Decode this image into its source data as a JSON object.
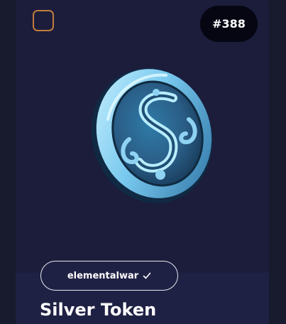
{
  "card": {
    "badge_number": "#388",
    "creator": {
      "name": "elementalwar",
      "icon": "check-icon"
    },
    "token_name": "Silver Token",
    "image_subject": "coin-icon"
  },
  "colors": {
    "background": "#181a2e",
    "card": "#1b1d3b",
    "card_lower": "#1f2144",
    "checkbox_border": "#c17b3e",
    "badge_bg": "#050612",
    "coin_light": "#8fd3f2",
    "coin_dark": "#1f4e73"
  }
}
